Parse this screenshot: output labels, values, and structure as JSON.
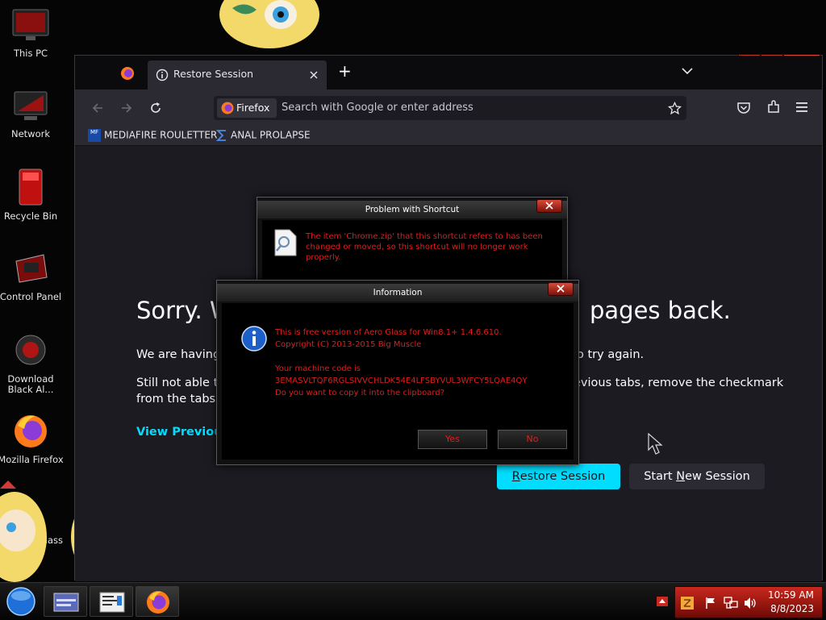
{
  "desktop": {
    "icons": [
      {
        "label": "This PC"
      },
      {
        "label": "Network"
      },
      {
        "label": "Recycle Bin"
      },
      {
        "label": "Control Panel"
      },
      {
        "label": "Download Black Al..."
      },
      {
        "label": "Mozilla Firefox"
      },
      {
        "label": "lass"
      }
    ]
  },
  "browser": {
    "tab_title": "Restore Session",
    "new_tab_symbol": "+",
    "url_identity": "Firefox",
    "url_placeholder": "Search with Google or enter address",
    "bookmarks": [
      {
        "icon_text": "MF",
        "label": "MEDIAFIRE ROULETTER"
      },
      {
        "label": "ANAL PROLAPSE"
      }
    ],
    "page": {
      "heading_left": "Sorry. W",
      "heading_right": "pages back.",
      "line1_left": "We are having",
      "line1_right": "o try again.",
      "line2_left": "Still not able to",
      "line2_right": "evious tabs, remove the checkmark",
      "line3_left": "from the tabs y",
      "view_previous": "View Previous",
      "restore_button": "Restore Session",
      "restore_mnemonic": "R",
      "restore_rest": "estore Session",
      "new_session_prefix": "Start ",
      "new_session_mnemonic": "N",
      "new_session_rest": "ew Session"
    }
  },
  "dialog_shortcut": {
    "title": "Problem with Shortcut",
    "message_line1": "The item 'Chrome.zip' that this shortcut refers to has been",
    "message_line2": "changed or moved, so this shortcut will no longer work properly."
  },
  "dialog_info": {
    "title": "Information",
    "line1": "This is free version of Aero Glass for Win8.1+ 1.4.6.610.",
    "line2": "Copyright (C) 2013-2015 Big Muscle",
    "line3": "Your machine code is",
    "line4": "3EMASVLTQF6RGLSIVVCHLDK54E4LFSBYVUL3WFCY5LQAE4QY",
    "line5": "Do you want to copy it into the clipboard?",
    "yes": "Yes",
    "no": "No"
  },
  "taskbar": {
    "time": "10:59 AM",
    "date": "8/8/2023"
  },
  "colors": {
    "accent_red": "#e01e1e",
    "restore_button": "#00ddff",
    "link_cyan": "#00ddff",
    "tray_red": "#c8281e"
  }
}
